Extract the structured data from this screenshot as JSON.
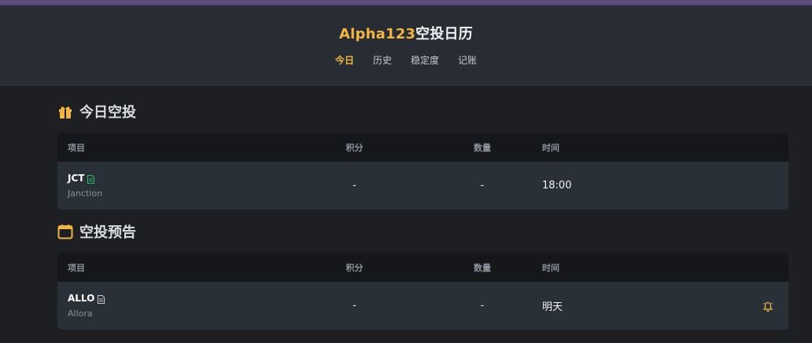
{
  "header": {
    "brand": "Alpha123",
    "title_rest": "空投日历",
    "nav": [
      {
        "label": "今日",
        "active": true
      },
      {
        "label": "历史",
        "active": false
      },
      {
        "label": "稳定度",
        "active": false
      },
      {
        "label": "记账",
        "active": false
      }
    ]
  },
  "today": {
    "title": "今日空投",
    "icon": "gift-icon",
    "columns": {
      "project": "项目",
      "points": "积分",
      "qty": "数量",
      "time": "时间"
    },
    "rows": [
      {
        "symbol": "JCT",
        "name": "Janction",
        "points": "-",
        "qty": "-",
        "time": "18:00",
        "doc_icon": "document-icon",
        "doc_color": "#2fb866"
      }
    ]
  },
  "upcoming": {
    "title": "空投预告",
    "icon": "calendar-icon",
    "columns": {
      "project": "项目",
      "points": "积分",
      "qty": "数量",
      "time": "时间"
    },
    "rows": [
      {
        "symbol": "ALLO",
        "name": "Allora",
        "points": "-",
        "qty": "-",
        "time": "明天",
        "doc_icon": "document-icon",
        "doc_color": "#c9cdd3",
        "action_icon": "bell-icon"
      }
    ]
  },
  "colors": {
    "accent": "#f3b53f",
    "background": "#1e1f23",
    "header_bg": "#282d34",
    "row_bg": "#2a3037",
    "table_head_bg": "#15171a"
  }
}
